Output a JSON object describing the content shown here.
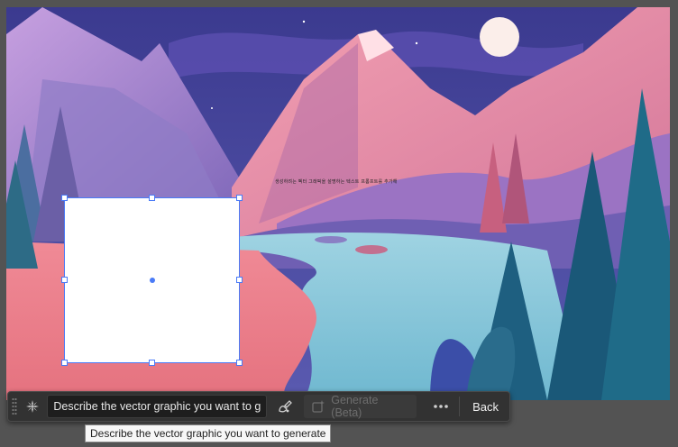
{
  "artboard": {
    "illustration": "mountain-lake-landscape",
    "note_text": "생성하려는 벡터 그래픽을 설명하는 텍스트 프롬프트를 추가해"
  },
  "taskbar": {
    "prompt_value": "Describe the vector graphic you want to g",
    "prompt_placeholder": "Describe the vector graphic you want to generate",
    "generate_label": "Generate (Beta)",
    "back_label": "Back",
    "icons": {
      "grip": "drag-handle-icon",
      "ai": "generative-ai-icon",
      "style": "style-picker-icon",
      "generate": "generate-icon",
      "more": "more-options-icon"
    }
  },
  "tooltip": {
    "text": "Describe the vector graphic you want to generate"
  },
  "colors": {
    "selection": "#4a7bf7",
    "panel": "#323232",
    "canvas": "#535353"
  }
}
